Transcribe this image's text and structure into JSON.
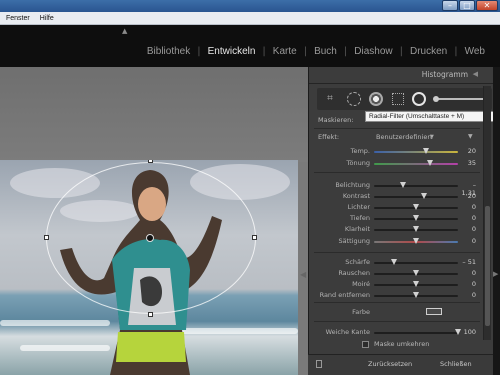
{
  "window": {
    "minimize": "–",
    "maximize": "□",
    "close": "✕"
  },
  "menu": [
    "Fenster",
    "Hilfe"
  ],
  "modules": [
    {
      "label": "Bibliothek",
      "active": false
    },
    {
      "label": "Entwickeln",
      "active": true
    },
    {
      "label": "Karte",
      "active": false
    },
    {
      "label": "Buch",
      "active": false
    },
    {
      "label": "Diashow",
      "active": false
    },
    {
      "label": "Drucken",
      "active": false
    },
    {
      "label": "Web",
      "active": false
    }
  ],
  "panel": {
    "histogram_title": "Histogramm",
    "tooltip": "Radial-Filter (Umschalttaste + M)",
    "mask_label": "Maskieren:",
    "effect_label": "Effekt:",
    "effect_value": "Benutzerdefiniert",
    "sliders": [
      {
        "label": "Temp.",
        "value": "20",
        "pos": 0.62,
        "grad": "linear-gradient(90deg,#3a5fa8,#c9b53c)"
      },
      {
        "label": "Tönung",
        "value": "35",
        "pos": 0.67,
        "grad": "linear-gradient(90deg,#3f9a4a,#b43fa8)"
      },
      {
        "label": "Belichtung",
        "value": "– 1,31",
        "pos": 0.34,
        "grad": ""
      },
      {
        "label": "Kontrast",
        "value": "20",
        "pos": 0.6,
        "grad": ""
      },
      {
        "label": "Lichter",
        "value": "0",
        "pos": 0.5,
        "grad": ""
      },
      {
        "label": "Tiefen",
        "value": "0",
        "pos": 0.5,
        "grad": ""
      },
      {
        "label": "Klarheit",
        "value": "0",
        "pos": 0.5,
        "grad": ""
      },
      {
        "label": "Sättigung",
        "value": "0",
        "pos": 0.5,
        "grad": "linear-gradient(90deg,#777,#b04a4a,#4a7ab0)"
      },
      {
        "label": "Schärfe",
        "value": "– 51",
        "pos": 0.24,
        "grad": ""
      },
      {
        "label": "Rauschen",
        "value": "0",
        "pos": 0.5,
        "grad": ""
      },
      {
        "label": "Moiré",
        "value": "0",
        "pos": 0.5,
        "grad": ""
      },
      {
        "label": "Rand entfernen",
        "value": "0",
        "pos": 0.5,
        "grad": ""
      }
    ],
    "color_label": "Farbe",
    "feather_label": "Weiche Kante",
    "feather_value": "100",
    "feather_pos": 1.0,
    "invert_label": "Maske umkehren",
    "reset_label": "Zurücksetzen",
    "close_label": "Schließen"
  }
}
